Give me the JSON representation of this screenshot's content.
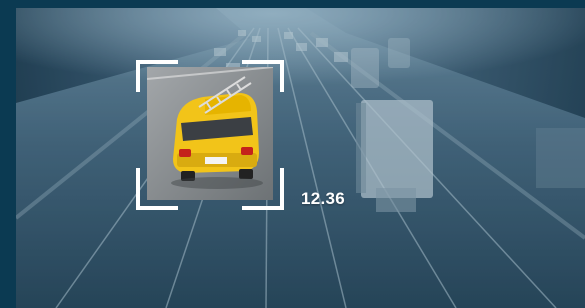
{
  "detection": {
    "value_label": "12.36",
    "object_icon": "taxi-car-icon",
    "frame_icon": "corner-bracket-icon",
    "accent_color": "#ffffff",
    "vehicle_color": "#f2c419"
  },
  "scene": {
    "background_color": "#0b3a52",
    "overlay_tint": "#3c5a70"
  }
}
